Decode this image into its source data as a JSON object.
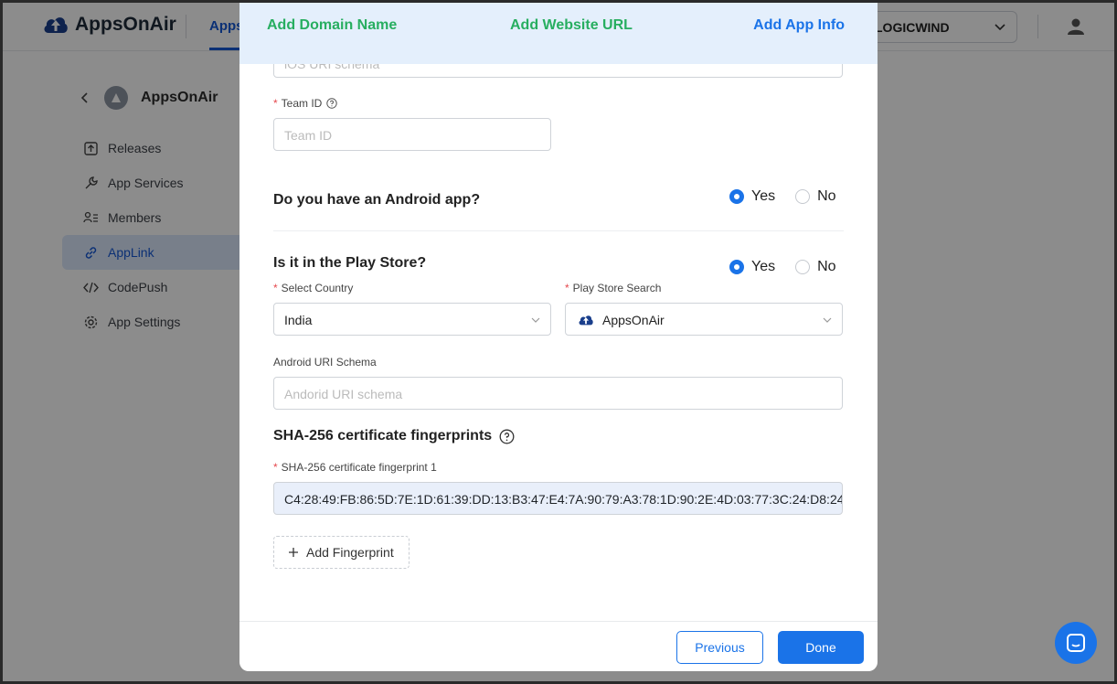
{
  "app": {
    "brand": "AppsOnAir",
    "top_tab": "Apps",
    "org_name": "LOGICWIND",
    "app_title": "AppsOnAir",
    "nav": [
      {
        "label": "Releases",
        "icon": "upload-box-icon"
      },
      {
        "label": "App Services",
        "icon": "wrench-icon"
      },
      {
        "label": "Members",
        "icon": "members-list-icon"
      },
      {
        "label": "AppLink",
        "icon": "link-icon",
        "active": true
      },
      {
        "label": "CodePush",
        "icon": "code-icon"
      },
      {
        "label": "App Settings",
        "icon": "gear-icon"
      }
    ]
  },
  "modal": {
    "steps": [
      "Add Domain Name",
      "Add Website URL",
      "Add App Info"
    ],
    "ios_uri_placeholder": "iOS URI schema",
    "team_id": {
      "label": "Team ID",
      "placeholder": "Team ID"
    },
    "android_question": {
      "label": "Do you have an Android app?",
      "yes": "Yes",
      "no": "No",
      "selected": "Yes"
    },
    "playstore_question": {
      "label": "Is it in the Play Store?",
      "yes": "Yes",
      "no": "No",
      "selected": "Yes"
    },
    "country": {
      "label": "Select Country",
      "value": "India"
    },
    "playstore_search": {
      "label": "Play Store Search",
      "value": "AppsOnAir"
    },
    "android_uri": {
      "label": "Android URI Schema",
      "placeholder": "Andorid URI schema"
    },
    "sha_section_title": "SHA-256 certificate fingerprints",
    "sha_field": {
      "label": "SHA-256 certificate fingerprint 1",
      "value": "C4:28:49:FB:86:5D:7E:1D:61:39:DD:13:B3:47:E4:7A:90:79:A3:78:1D:90:2E:4D:03:77:3C:24:D8:24"
    },
    "add_fingerprint": "Add Fingerprint",
    "previous": "Previous",
    "done": "Done"
  },
  "colors": {
    "accent": "#1a73e8",
    "success": "#27ae60",
    "required": "#e5484d"
  }
}
